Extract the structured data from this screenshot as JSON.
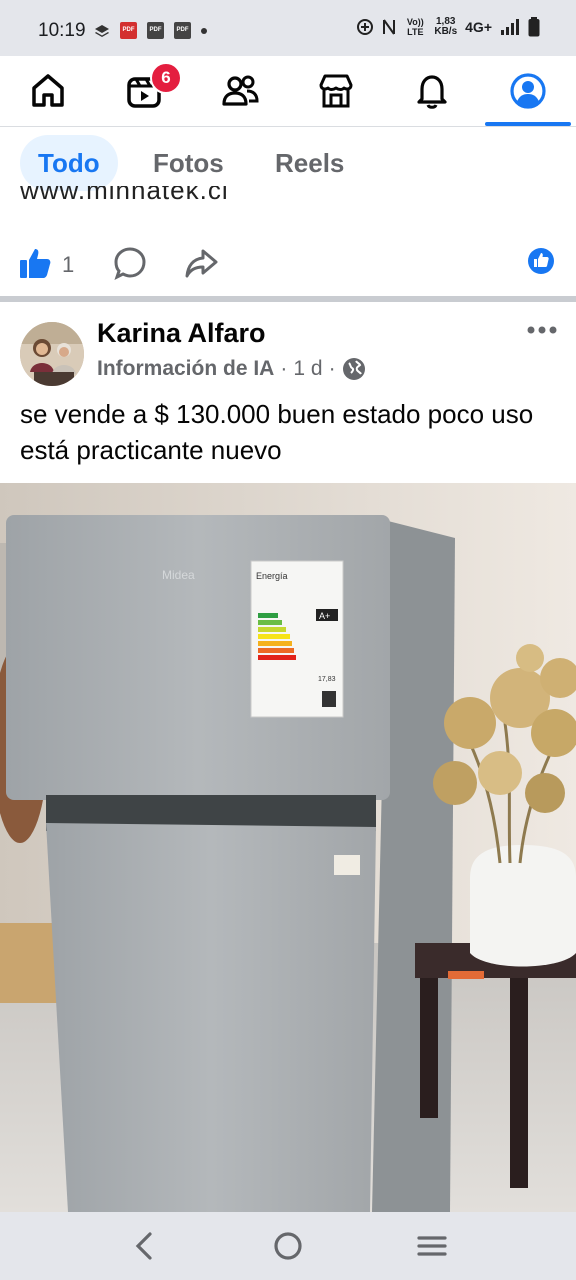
{
  "status_bar": {
    "time": "10:19",
    "lte_label": "Vo)) LTE",
    "speed_top": "1,83",
    "speed_bottom": "KB/s",
    "network": "4G+",
    "pdf_label": "PDF"
  },
  "nav": {
    "notification_count": "6",
    "active_tab": "profile",
    "items": [
      "home",
      "video",
      "friends",
      "marketplace",
      "notifications",
      "profile"
    ]
  },
  "filters": {
    "items": [
      "Todo",
      "Fotos",
      "Reels"
    ],
    "active": "Todo"
  },
  "previous_post": {
    "url_fragment": "www.minnatek.cl",
    "like_count": "1"
  },
  "post": {
    "author": "Karina Alfaro",
    "group": "Información de IA",
    "separator": "·",
    "time": "1 d",
    "text": "se vende a $ 130.000 buen estado poco uso está practicante nuevo",
    "image_label": {
      "brand": "Midea",
      "energy_title": "Energía",
      "rating": "A+",
      "consumption": "17,83"
    }
  },
  "colors": {
    "accent": "#1877f2",
    "badge": "#e41e3f",
    "muted": "#65676b",
    "status_bg": "#e4e6eb"
  }
}
